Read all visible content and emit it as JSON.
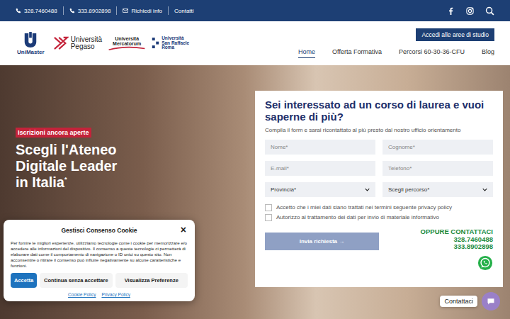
{
  "topbar": {
    "contacts": [
      {
        "kind": "phone",
        "label": "328.7460488"
      },
      {
        "kind": "phone",
        "label": "333.8902898"
      },
      {
        "kind": "mail",
        "label": "Richiedi info"
      },
      {
        "kind": "link",
        "label": "Contatti"
      }
    ]
  },
  "logos": [
    {
      "kind": "unimaster",
      "lines": [
        "UniMaster"
      ]
    },
    {
      "kind": "pegaso",
      "lines": [
        "Università",
        "Pegaso"
      ]
    },
    {
      "kind": "mercatorum",
      "lines": [
        "Università",
        "Mercatorum"
      ]
    },
    {
      "kind": "sanraffaele",
      "lines": [
        "Università",
        "San Raffaele",
        "Roma"
      ]
    }
  ],
  "header": {
    "cta": "Accedi alle aree di studio",
    "nav": [
      {
        "label": "Home",
        "selected": true
      },
      {
        "label": "Offerta Formativa",
        "selected": false
      },
      {
        "label": "Percorsi 60-30-36-CFU",
        "selected": false
      },
      {
        "label": "Blog",
        "selected": false
      }
    ]
  },
  "hero": {
    "badge": "Iscrizioni ancora aperte",
    "headline": [
      "Scegli l'Ateneo",
      "Digitale Leader",
      "in Italia"
    ],
    "mark": "*"
  },
  "form": {
    "title": "Sei interessato ad un corso di laurea e vuoi saperne di più?",
    "subtitle": "Compila il form e sarai ricontattato al più presto dal nostro ufficio orientamento",
    "fields": [
      {
        "kind": "input",
        "placeholder": "Nome*"
      },
      {
        "kind": "input",
        "placeholder": "Cognome*"
      },
      {
        "kind": "input",
        "placeholder": "E-mail*"
      },
      {
        "kind": "input",
        "placeholder": "Telefono*"
      },
      {
        "kind": "select",
        "placeholder": "Provincia*"
      },
      {
        "kind": "select",
        "placeholder": "Scegli percorso*"
      }
    ],
    "consents": [
      {
        "label": "Accetto che i miei dati siano trattati nei termini seguente privacy policy",
        "checked": false
      },
      {
        "label": "Autorizzo al trattamento dei dati per invio di materiale informativo",
        "checked": false
      }
    ],
    "submit": {
      "label": "Invia richiesta",
      "arrow": "→"
    },
    "contact": {
      "title": "OPPURE CONTATTACI",
      "phones": [
        "328.7460488",
        "333.8902898"
      ]
    }
  },
  "cookie": {
    "title": "Gestisci Consenso Cookie",
    "close": "×",
    "body": "Per fornire le migliori esperienze, utilizziamo tecnologie come i cookie per memorizzare e/o accedere alle informazioni del dispositivo. Il consenso a queste tecnologie ci permetterà di elaborare dati come il comportamento di navigazione o ID unici su questo sito. Non acconsentire o ritirare il consenso può influire negativamente su alcune caratteristiche e funzioni.",
    "buttons": [
      {
        "label": "Accetta",
        "kind": "primary"
      },
      {
        "label": "Continua senza accettare",
        "kind": "secondary"
      },
      {
        "label": "Visualizza Preferenze",
        "kind": "secondary"
      }
    ],
    "links": [
      "Cookie Policy",
      "Privacy Policy"
    ]
  },
  "chat": {
    "label": "Contattaci"
  }
}
